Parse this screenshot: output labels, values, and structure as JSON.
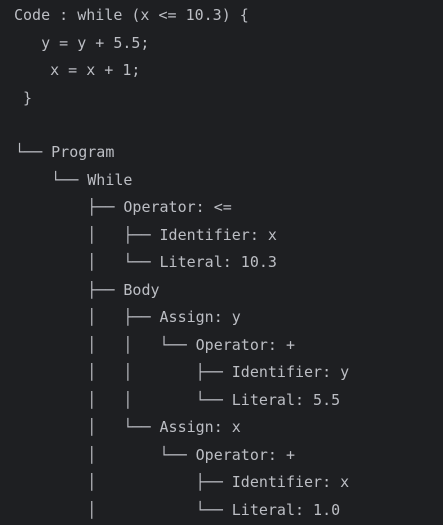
{
  "output": {
    "code_lines": [
      "Code : while (x <= 10.3) {",
      "   y = y + 5.5;",
      "    x = x + 1;",
      " }"
    ],
    "tree_lines": [
      " └── Program",
      "     └── While",
      "         ├── Operator: <=",
      "         │   ├── Identifier: x",
      "         │   └── Literal: 10.3",
      "         ├── Body",
      "         │   ├── Assign: y",
      "         │   │   └── Operator: +",
      "         │   │       ├── Identifier: y",
      "         │   │       └── Literal: 5.5",
      "         │   └── Assign: x",
      "         │       └── Operator: +",
      "         │           ├── Identifier: x",
      "         │           └── Literal: 1.0"
    ]
  },
  "colors": {
    "background": "#1e1f22",
    "text": "#bcbec4"
  }
}
